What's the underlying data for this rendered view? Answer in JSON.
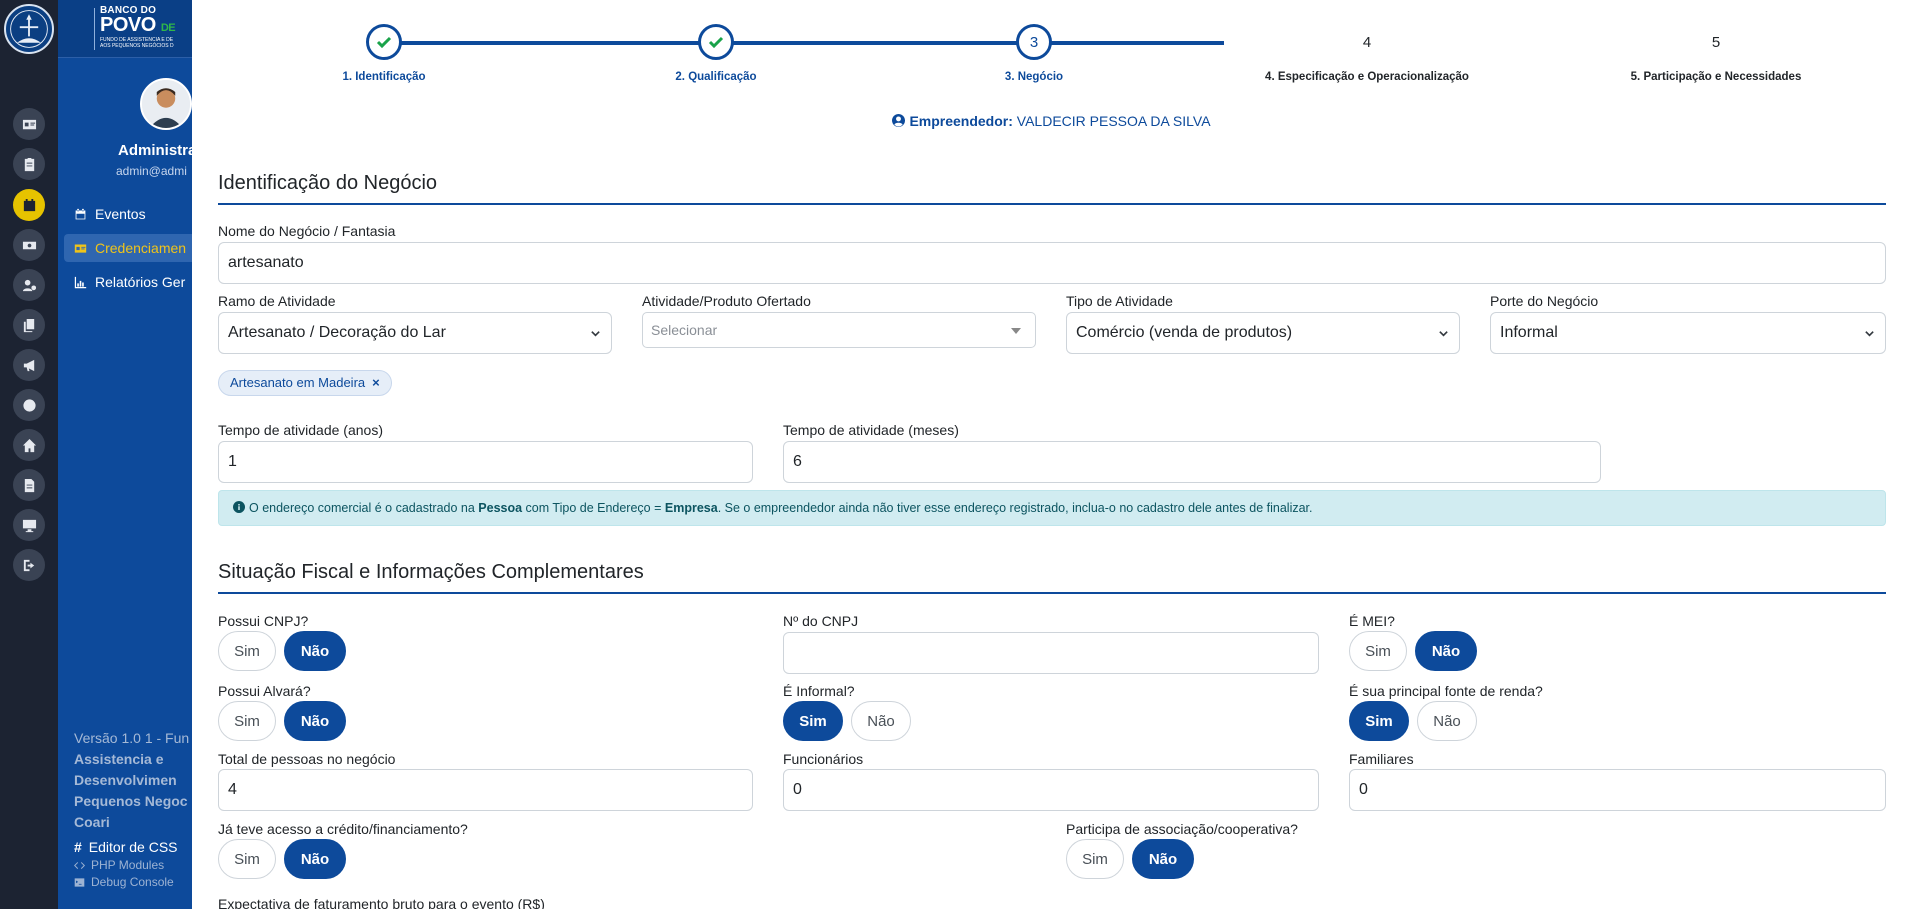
{
  "colors": {
    "primary": "#0d4a9b",
    "rail": "#1c2332",
    "accent": "#f0c419",
    "info_bg": "#d1ecf1"
  },
  "brand": {
    "line1": "BANCO DO",
    "line2": "POVO",
    "line2_suffix": "DE",
    "line3": "FUNDO DE ASSISTÊNCIA E DE",
    "line4": "AOS PEQUENOS NEGÓCIOS D"
  },
  "user": {
    "name": "Administra",
    "email": "admin@admi"
  },
  "sidebar": {
    "items": [
      {
        "label": "Eventos",
        "icon": "calendar-icon"
      },
      {
        "label": "Credenciamen",
        "icon": "id-card-icon"
      },
      {
        "label": "Relatórios Ger",
        "icon": "chart-icon"
      }
    ],
    "version_lines": [
      "Versão 1.0 1 - Fun",
      "Assistencia e",
      "Desenvolvimen",
      "Pequenos Negoc",
      "Coari"
    ],
    "css_editor": "Editor de CSS",
    "php_modules": "PHP Modules",
    "debug_console": "Debug Console"
  },
  "rail_icons": [
    "id-card-icon",
    "clipboard-icon",
    "calendar-icon",
    "money-icon",
    "users-cog-icon",
    "copy-icon",
    "bullhorn-icon",
    "globe-icon",
    "home-icon",
    "file-icon",
    "desktop-icon",
    "logout-icon"
  ],
  "stepper": {
    "steps": [
      {
        "number": "1",
        "label": "1. Identificação",
        "state": "done"
      },
      {
        "number": "2",
        "label": "2. Qualificação",
        "state": "done"
      },
      {
        "number": "3",
        "label": "3. Negócio",
        "state": "current"
      },
      {
        "number": "4",
        "label": "4. Especificação e Operacionalização",
        "state": "future"
      },
      {
        "number": "5",
        "label": "5. Participação e Necessidades",
        "state": "future"
      }
    ]
  },
  "entrepreneur": {
    "label": "Empreendedor:",
    "name": "VALDECIR PESSOA DA SILVA"
  },
  "section1": {
    "title": "Identificação do Negócio",
    "business_name": {
      "label": "Nome do Negócio / Fantasia",
      "value": "artesanato"
    },
    "branch": {
      "label": "Ramo de Atividade",
      "value": "Artesanato / Decoração do Lar"
    },
    "product": {
      "label": "Atividade/Produto Ofertado",
      "placeholder": "Selecionar"
    },
    "activity_type": {
      "label": "Tipo de Atividade",
      "value": "Comércio (venda de produtos)"
    },
    "size": {
      "label": "Porte do Negócio",
      "value": "Informal"
    },
    "tag": "Artesanato em Madeira",
    "tag_remove": "×",
    "years": {
      "label": "Tempo de atividade (anos)",
      "value": "1"
    },
    "months": {
      "label": "Tempo de atividade (meses)",
      "value": "6"
    }
  },
  "alert": {
    "part1": "O endereço comercial é o cadastrado na ",
    "pessoa": "Pessoa",
    "part2": " com Tipo de Endereço = ",
    "empresa": "Empresa",
    "part3": ". Se o empreendedor ainda não tiver esse endereço registrado, inclua-o no cadastro dele antes de finalizar."
  },
  "section2": {
    "title": "Situação Fiscal e Informações Complementares",
    "yes": "Sim",
    "no": "Não",
    "cnpj_q": {
      "label": "Possui CNPJ?",
      "selected": "no"
    },
    "cnpj_number": {
      "label": "Nº do CNPJ",
      "value": ""
    },
    "mei_q": {
      "label": "É MEI?",
      "selected": "no"
    },
    "alvara_q": {
      "label": "Possui Alvará?",
      "selected": "no"
    },
    "informal_q": {
      "label": "É Informal?",
      "selected": "yes"
    },
    "main_income_q": {
      "label": "É sua principal fonte de renda?",
      "selected": "yes"
    },
    "total_people": {
      "label": "Total de pessoas no negócio",
      "value": "4"
    },
    "employees": {
      "label": "Funcionários",
      "value": "0"
    },
    "family": {
      "label": "Familiares",
      "value": "0"
    },
    "credit_q": {
      "label": "Já teve acesso a crédito/financiamento?",
      "selected": "no"
    },
    "association_q": {
      "label": "Participa de associação/cooperativa?",
      "selected": "no"
    },
    "revenue_label": "Expectativa de faturamento bruto para o evento (R$)"
  }
}
